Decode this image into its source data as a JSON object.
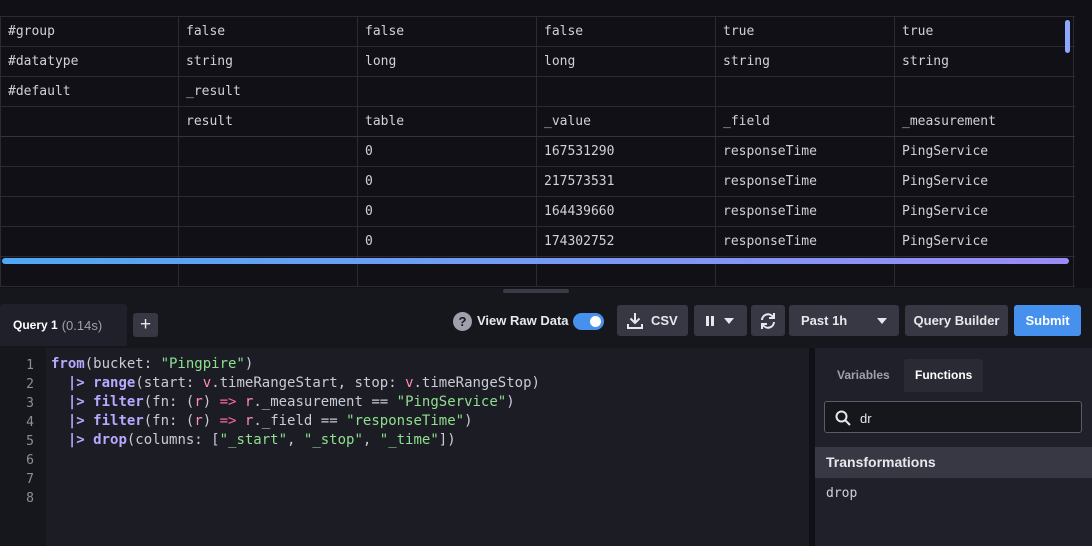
{
  "table": {
    "rows": [
      [
        "#group",
        "false",
        "false",
        "false",
        "true",
        "true"
      ],
      [
        "#datatype",
        "string",
        "long",
        "long",
        "string",
        "string"
      ],
      [
        "#default",
        "_result",
        "",
        "",
        "",
        ""
      ],
      [
        "",
        "result",
        "table",
        "_value",
        "_field",
        "_measurement"
      ],
      [
        "",
        "",
        "0",
        "167531290",
        "responseTime",
        "PingService"
      ],
      [
        "",
        "",
        "0",
        "217573531",
        "responseTime",
        "PingService"
      ],
      [
        "",
        "",
        "0",
        "164439660",
        "responseTime",
        "PingService"
      ],
      [
        "",
        "",
        "0",
        "174302752",
        "responseTime",
        "PingService"
      ],
      [
        "",
        "",
        "",
        "",
        "",
        ""
      ]
    ]
  },
  "toolbar": {
    "query_tab_name": "Query 1",
    "query_tab_time": "(0.14s)",
    "add_label": "+",
    "help_label": "?",
    "raw_data_label": "View Raw Data",
    "raw_data_on": true,
    "csv_label": "CSV",
    "time_range": "Past 1h",
    "query_builder_label": "Query Builder",
    "submit_label": "Submit"
  },
  "editor": {
    "line_numbers": [
      "1",
      "2",
      "3",
      "4",
      "5",
      "6",
      "7",
      "8"
    ],
    "lines": [
      [
        [
          "kw",
          "from"
        ],
        [
          "p",
          "(bucket: "
        ],
        [
          "str",
          "\"Pingpire\""
        ],
        [
          "p",
          ")"
        ]
      ],
      [
        [
          "p",
          "  "
        ],
        [
          "kw",
          "|>"
        ],
        [
          "p",
          " "
        ],
        [
          "kw",
          "range"
        ],
        [
          "p",
          "(start: "
        ],
        [
          "v",
          "v"
        ],
        [
          "p",
          ".timeRangeStart, stop: "
        ],
        [
          "v",
          "v"
        ],
        [
          "p",
          ".timeRangeStop)"
        ]
      ],
      [
        [
          "p",
          "  "
        ],
        [
          "kw",
          "|>"
        ],
        [
          "p",
          " "
        ],
        [
          "kw",
          "filter"
        ],
        [
          "p",
          "(fn: ("
        ],
        [
          "v",
          "r"
        ],
        [
          "p",
          ") "
        ],
        [
          "op",
          "=>"
        ],
        [
          "p",
          " "
        ],
        [
          "v",
          "r"
        ],
        [
          "p",
          "._measurement == "
        ],
        [
          "str",
          "\"PingService\""
        ],
        [
          "p",
          ")"
        ]
      ],
      [
        [
          "p",
          "  "
        ],
        [
          "kw",
          "|>"
        ],
        [
          "p",
          " "
        ],
        [
          "kw",
          "filter"
        ],
        [
          "p",
          "(fn: ("
        ],
        [
          "v",
          "r"
        ],
        [
          "p",
          ") "
        ],
        [
          "op",
          "=>"
        ],
        [
          "p",
          " "
        ],
        [
          "v",
          "r"
        ],
        [
          "p",
          "._field == "
        ],
        [
          "str",
          "\"responseTime\""
        ],
        [
          "p",
          ")"
        ]
      ],
      [
        [
          "p",
          "  "
        ],
        [
          "kw",
          "|>"
        ],
        [
          "p",
          " "
        ],
        [
          "kw",
          "drop"
        ],
        [
          "p",
          "(columns: ["
        ],
        [
          "str",
          "\"_start\""
        ],
        [
          "p",
          ", "
        ],
        [
          "str",
          "\"_stop\""
        ],
        [
          "p",
          ", "
        ],
        [
          "str",
          "\"_time\""
        ],
        [
          "p",
          "])"
        ]
      ]
    ]
  },
  "side_panel": {
    "tabs": [
      "Variables",
      "Functions"
    ],
    "active_tab": "Functions",
    "search_value": "dr",
    "category": "Transformations",
    "functions": [
      "drop"
    ]
  },
  "colors": {
    "accent": "#4591ed",
    "keyword": "#b8a8ff",
    "string": "#8ee08f"
  }
}
